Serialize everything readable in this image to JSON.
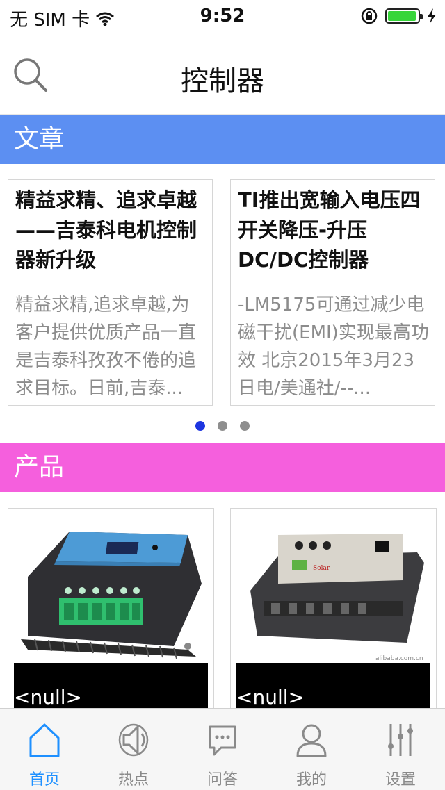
{
  "status_bar": {
    "carrier": "无 SIM 卡",
    "time": "9:52"
  },
  "nav": {
    "title": "控制器"
  },
  "sections": {
    "articles_title": "文章",
    "products_title": "产品"
  },
  "articles": [
    {
      "title": "精益求精、追求卓越——吉泰科电机控制器新升级",
      "summary": "精益求精,追求卓越,为客户提供优质产品一直是吉泰科孜孜不倦的追求目标。日前,吉泰..."
    },
    {
      "title": "TI推出宽输入电压四开关降压-升压DC/DC控制器",
      "summary": "-LM5175可通过减少电磁干扰(EMI)实现最高功效 北京2015年3月23日电/美通社/--..."
    }
  ],
  "pager": {
    "count": 3,
    "active_index": 0
  },
  "products": [
    {
      "caption": "<null>"
    },
    {
      "caption": "<null>"
    }
  ],
  "tabs": [
    {
      "label": "首页",
      "icon": "home-icon",
      "active": true
    },
    {
      "label": "热点",
      "icon": "speaker-icon",
      "active": false
    },
    {
      "label": "问答",
      "icon": "chat-icon",
      "active": false
    },
    {
      "label": "我的",
      "icon": "person-icon",
      "active": false
    },
    {
      "label": "设置",
      "icon": "sliders-icon",
      "active": false
    }
  ],
  "colors": {
    "articles_header": "#5c8ff2",
    "products_header": "#f55fdd",
    "tab_active": "#1e90ff",
    "pager_active": "#1d35e0"
  }
}
